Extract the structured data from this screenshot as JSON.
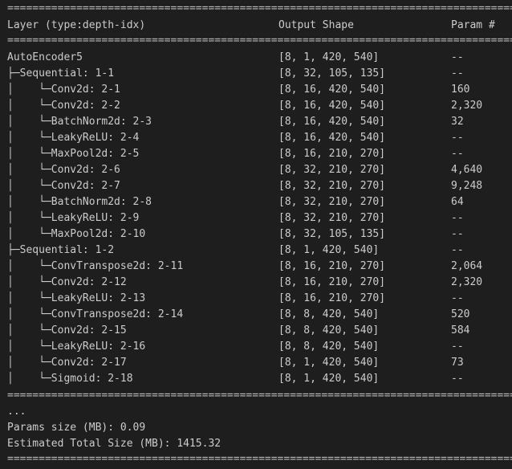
{
  "separator_double": "================================================================================================",
  "separator_dash": "------------------------------------------------------------------------------------------------",
  "header": {
    "layer": "Layer (type:depth-idx)",
    "output_shape": "Output Shape",
    "param": "Param #"
  },
  "rows": [
    {
      "layer": "AutoEncoder5",
      "shape": "[8, 1, 420, 540]",
      "param": "--"
    },
    {
      "layer": "├─Sequential: 1-1",
      "shape": "[8, 32, 105, 135]",
      "param": "--"
    },
    {
      "layer": "│    └─Conv2d: 2-1",
      "shape": "[8, 16, 420, 540]",
      "param": "160"
    },
    {
      "layer": "│    └─Conv2d: 2-2",
      "shape": "[8, 16, 420, 540]",
      "param": "2,320"
    },
    {
      "layer": "│    └─BatchNorm2d: 2-3",
      "shape": "[8, 16, 420, 540]",
      "param": "32"
    },
    {
      "layer": "│    └─LeakyReLU: 2-4",
      "shape": "[8, 16, 420, 540]",
      "param": "--"
    },
    {
      "layer": "│    └─MaxPool2d: 2-5",
      "shape": "[8, 16, 210, 270]",
      "param": "--"
    },
    {
      "layer": "│    └─Conv2d: 2-6",
      "shape": "[8, 32, 210, 270]",
      "param": "4,640"
    },
    {
      "layer": "│    └─Conv2d: 2-7",
      "shape": "[8, 32, 210, 270]",
      "param": "9,248"
    },
    {
      "layer": "│    └─BatchNorm2d: 2-8",
      "shape": "[8, 32, 210, 270]",
      "param": "64"
    },
    {
      "layer": "│    └─LeakyReLU: 2-9",
      "shape": "[8, 32, 210, 270]",
      "param": "--"
    },
    {
      "layer": "│    └─MaxPool2d: 2-10",
      "shape": "[8, 32, 105, 135]",
      "param": "--"
    },
    {
      "layer": "├─Sequential: 1-2",
      "shape": "[8, 1, 420, 540]",
      "param": "--"
    },
    {
      "layer": "│    └─ConvTranspose2d: 2-11",
      "shape": "[8, 16, 210, 270]",
      "param": "2,064"
    },
    {
      "layer": "│    └─Conv2d: 2-12",
      "shape": "[8, 16, 210, 270]",
      "param": "2,320"
    },
    {
      "layer": "│    └─LeakyReLU: 2-13",
      "shape": "[8, 16, 210, 270]",
      "param": "--"
    },
    {
      "layer": "│    └─ConvTranspose2d: 2-14",
      "shape": "[8, 8, 420, 540]",
      "param": "520"
    },
    {
      "layer": "│    └─Conv2d: 2-15",
      "shape": "[8, 8, 420, 540]",
      "param": "584"
    },
    {
      "layer": "│    └─LeakyReLU: 2-16",
      "shape": "[8, 8, 420, 540]",
      "param": "--"
    },
    {
      "layer": "│    └─Conv2d: 2-17",
      "shape": "[8, 1, 420, 540]",
      "param": "73"
    },
    {
      "layer": "│    └─Sigmoid: 2-18",
      "shape": "[8, 1, 420, 540]",
      "param": "--"
    }
  ],
  "footer": {
    "ellipsis": "...",
    "params_size": "Params size (MB): 0.09",
    "total_size": "Estimated Total Size (MB): 1415.32"
  }
}
